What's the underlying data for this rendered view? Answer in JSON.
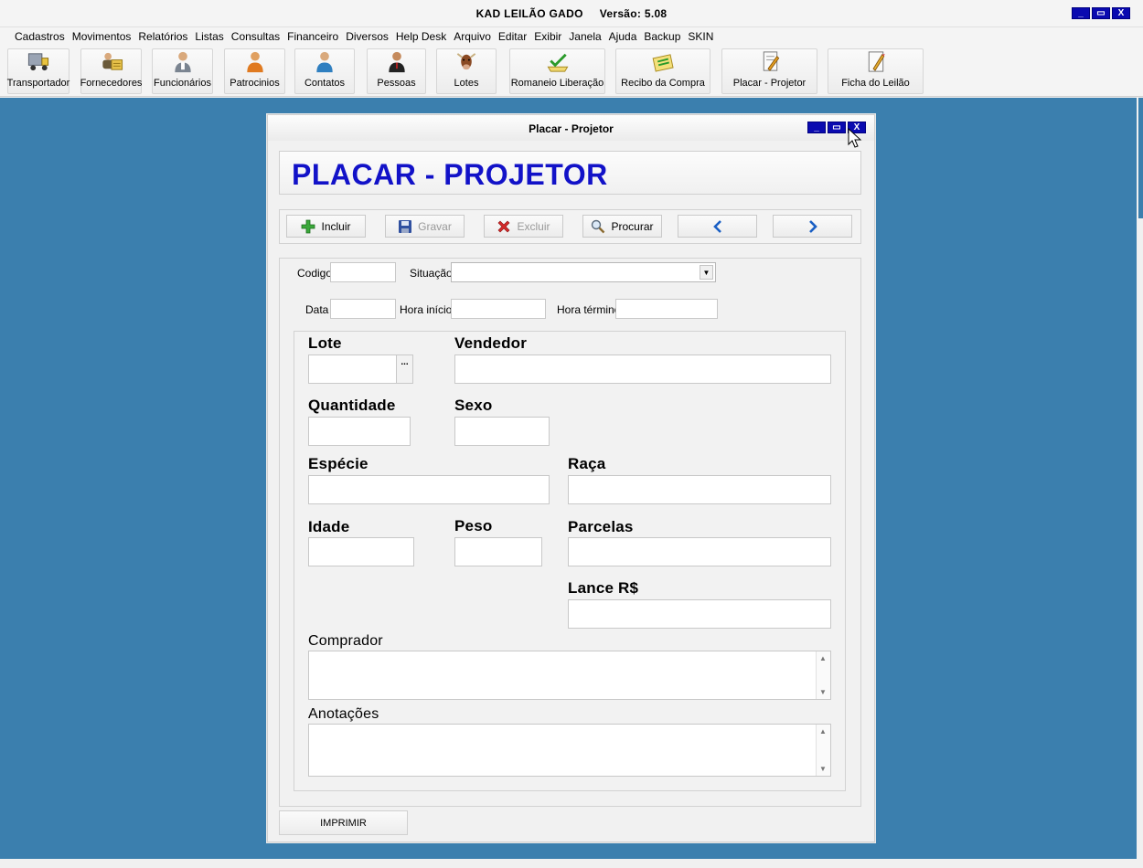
{
  "app": {
    "name": "KAD LEILÃO GADO",
    "version": "Versão: 5.08"
  },
  "window_buttons": {
    "minimize": "_",
    "maximize": "▭",
    "close": "X"
  },
  "menu": [
    "Cadastros",
    "Movimentos",
    "Relatórios",
    "Listas",
    "Consultas",
    "Financeiro",
    "Diversos",
    "Help Desk",
    "Arquivo",
    "Editar",
    "Exibir",
    "Janela",
    "Ajuda",
    "Backup",
    "SKIN"
  ],
  "toolbar": [
    {
      "label": "Transportador",
      "icon": "truck-icon"
    },
    {
      "label": "Fornecedores",
      "icon": "suppliers-icon"
    },
    {
      "label": "Funcionários",
      "icon": "employee-icon"
    },
    {
      "label": "Patrocinios",
      "icon": "sponsor-icon"
    },
    {
      "label": "Contatos",
      "icon": "contact-icon"
    },
    {
      "label": "Pessoas",
      "icon": "person-icon"
    },
    {
      "label": "Lotes",
      "icon": "cattle-icon"
    },
    {
      "label": "Romaneio Liberação",
      "icon": "release-icon"
    },
    {
      "label": "Recibo da Compra",
      "icon": "receipt-icon"
    },
    {
      "label": "Placar - Projetor",
      "icon": "scoreboard-icon"
    },
    {
      "label": "Ficha do Leilão",
      "icon": "auction-sheet-icon"
    }
  ],
  "child": {
    "title": "Placar - Projetor",
    "form_title": "PLACAR - PROJETOR",
    "nav": {
      "incluir": "Incluir",
      "gravar": "Gravar",
      "excluir": "Excluir",
      "procurar": "Procurar"
    },
    "fields": {
      "codigo": "Codigo",
      "situacao": "Situação",
      "data": "Data",
      "hora_inicio": "Hora início",
      "hora_termino": "Hora término"
    },
    "big_fields": {
      "lote": "Lote",
      "vendedor": "Vendedor",
      "quantidade": "Quantidade",
      "sexo": "Sexo",
      "especie": "Espécie",
      "raca": "Raça",
      "idade": "Idade",
      "peso": "Peso",
      "parcelas": "Parcelas",
      "lance": "Lance R$",
      "comprador": "Comprador",
      "anotacoes": "Anotações"
    },
    "lote_button": "...",
    "print": "IMPRIMIR"
  }
}
